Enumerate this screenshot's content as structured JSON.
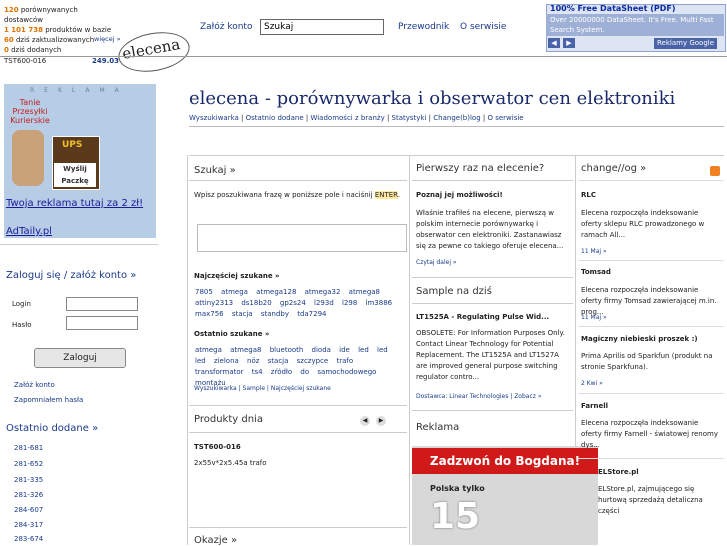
{
  "header": {
    "stats": [
      {
        "num": "120",
        "label": "porównywanych dostawców"
      },
      {
        "num": "1 101 738",
        "label": "produktów w bazie"
      },
      {
        "num": "60",
        "label": "dziś zaktualizowanych"
      },
      {
        "num": "0",
        "label": "dziś dodanych"
      }
    ],
    "more_label": "więcej »",
    "logo": "elecena",
    "ticker_part": "TST600-016",
    "ticker_price": "249.03",
    "nav": {
      "register": "Załóż konto",
      "search_value": "Szukaj",
      "guide": "Przewodnik",
      "about": "O serwisie"
    }
  },
  "ad": {
    "title": "100% Free DataSheet (PDF)",
    "body": "Over 20000000 DataSheet. It's Free. Multi Fast Search System.",
    "prev": "◀",
    "next": "▶",
    "google": "Reklamy Google"
  },
  "left": {
    "reklama": "REKLAMA",
    "tanie": "Tanie Przesyłki Kurierskie",
    "ups": "UPS",
    "wyslij": "Wyślij Paczkę",
    "twoja": "Twoja reklama tutaj za 2 zł!",
    "adtaily": "AdTaily.pl",
    "login_heading": "Zaloguj się / załóż konto »",
    "login_label": "Login",
    "password_label": "Hasło",
    "login_button": "Zaloguj",
    "link_register": "Załóż konto",
    "link_forgot": "Zapomniałem hasła",
    "recent_heading": "Ostatnio dodane »",
    "ranges": [
      "281-681",
      "281-652",
      "281-335",
      "281-326",
      "284-607",
      "284-317",
      "283-674"
    ]
  },
  "main": {
    "title": "elecena - porównywarka i obserwator cen elektroniki",
    "crumbs": [
      "Wyszukiwarka",
      "Ostatnio dodane",
      "Wiadomości z branży",
      "Statystyki",
      "Change(b)log",
      "O serwisie"
    ],
    "search_heading": "Szukaj »",
    "search_desc": "Wpisz poszukiwana frazę w poniższe pole i naciśnij",
    "search_enter": "ENTER",
    "popular_heading": "Najczęściej szukane »",
    "popular": "7805 atmega atmega128 atmega32 atmega8 attiny2313 ds18b20 gp2s24 l293d l298 lm3886 max756 stacja standby tda7294",
    "recent_heading": "Ostatnio szukane »",
    "recent": "atmega atmega8 bluetooth dioda ide led led led zielona nöz stacja szczypce trafo transformator ts4 zŕódło do samochodowego montażu",
    "search_footer": "Wyszukiwarka | Sample | Najczęściej szukane",
    "products_heading": "Produkty dnia",
    "product_name": "TST600-016",
    "product_desc": "2x55v*2x5.45a trafo",
    "deals_heading": "Okazje »"
  },
  "middle": {
    "first_heading": "Pierwszy raz na elecenie?",
    "first_sub": "Poznaj jej możliwości!",
    "first_text": "Właśnie trafiłeś na elecene, pierwszą w polskim internecie porównywarkę i obserwator cen elektroniki. Zastanawiasz się za pewne co takiego oferuje elecena...",
    "first_more": "Czytaj dalej »",
    "sample_heading": "Sample na dziś",
    "sample_name": "LT1525A - Regulating Pulse Wid...",
    "sample_text": "OBSOLETE: For Information Purposes Only. Contact Linear Technology for Potential Replacement. The LT1525A and LT1527A are improved general purpose switching regulator contro...",
    "sample_footer": "Dostawca: Linear Technologies | Zobacz »",
    "ad_heading": "Reklama",
    "ad_banner": "Zadzwoń do Bogdana!",
    "ad_polska": "Polska tylko",
    "ad_number": "15"
  },
  "right": {
    "heading": "change//og »",
    "entries": [
      {
        "title": "RLC",
        "text": "Elecena rozpoczęła indeksowanie oferty sklepu RLC prowadzonego w ramach All...",
        "date": "11 Maj »"
      },
      {
        "title": "Tomsad",
        "text": "Elecena rozpoczęła indeksowanie oferty firmy Tomsad zawierającej m.in. prog...",
        "date": "11 Maj »"
      },
      {
        "title": "Magiczny niebieski proszek :)",
        "text": "Prima Aprilis od Sparkfun (produkt na stronie Sparkfuna).",
        "date": "2 Kwi »"
      },
      {
        "title": "Farnell",
        "text": "Elecena rozpoczęła indeksowanie oferty firmy Farnell - światowej renomy dys...",
        "date": ""
      },
      {
        "title": "ELStore.pl",
        "text": "ELStore.pl, zajmującego się hurtową sprzedażą detaliczna części",
        "date": ""
      }
    ]
  }
}
